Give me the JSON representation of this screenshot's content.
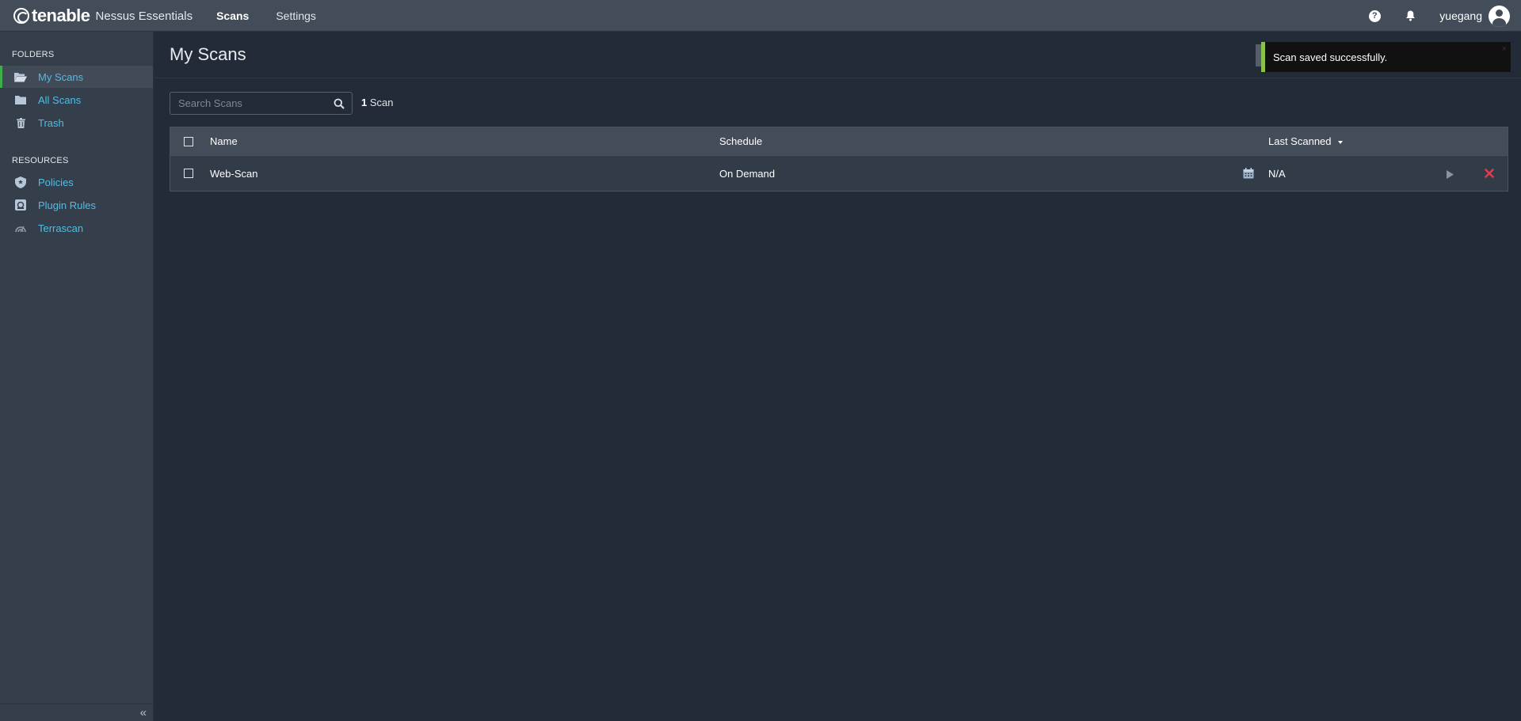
{
  "header": {
    "brand": "tenable",
    "product": "Nessus Essentials",
    "tabs": [
      {
        "label": "Scans",
        "active": true
      },
      {
        "label": "Settings",
        "active": false
      }
    ],
    "help_glyph": "?",
    "username": "yuegang"
  },
  "sidebar": {
    "folders_title": "FOLDERS",
    "folders": [
      {
        "label": "My Scans",
        "icon": "folder-open-icon",
        "active": true
      },
      {
        "label": "All Scans",
        "icon": "folder-icon",
        "active": false
      },
      {
        "label": "Trash",
        "icon": "trash-icon",
        "active": false
      }
    ],
    "resources_title": "RESOURCES",
    "resources": [
      {
        "label": "Policies",
        "icon": "policy-badge-icon"
      },
      {
        "label": "Plugin Rules",
        "icon": "plugin-rules-icon"
      },
      {
        "label": "Terrascan",
        "icon": "terrascan-icon"
      }
    ],
    "collapse_glyph": "«"
  },
  "main": {
    "title": "My Scans",
    "search_placeholder": "Search Scans",
    "scan_count_number": "1",
    "scan_count_label": "Scan",
    "table": {
      "headers": {
        "name": "Name",
        "schedule": "Schedule",
        "last_scanned": "Last Scanned"
      },
      "rows": [
        {
          "name": "Web-Scan",
          "schedule": "On Demand",
          "last_scanned": "N/A"
        }
      ]
    }
  },
  "toast": {
    "message": "Scan saved successfully.",
    "close_glyph": "×"
  },
  "colors": {
    "accent_link": "#4dbde6",
    "active_indicator": "#3fae49",
    "toast_accent": "#8ac24a",
    "delete_red": "#e03c4b"
  }
}
